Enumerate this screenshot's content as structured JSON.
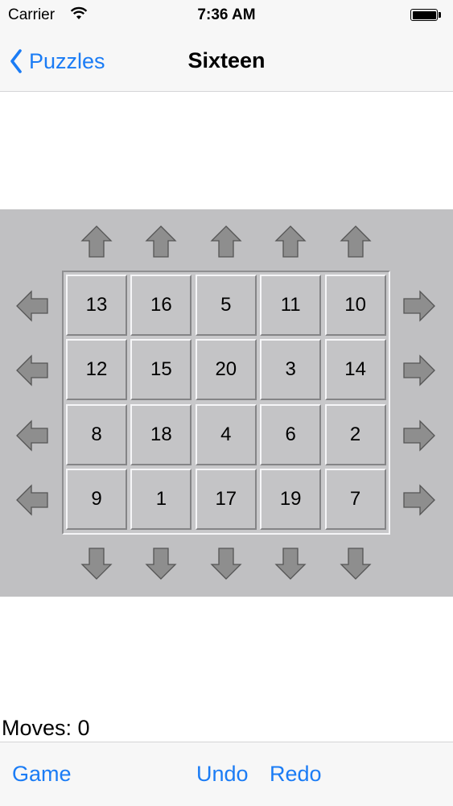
{
  "status": {
    "carrier": "Carrier",
    "time": "7:36 AM"
  },
  "nav": {
    "back_label": "Puzzles",
    "title": "Sixteen"
  },
  "board": {
    "rows": [
      [
        "13",
        "16",
        "5",
        "11",
        "10"
      ],
      [
        "12",
        "15",
        "20",
        "3",
        "14"
      ],
      [
        "8",
        "18",
        "4",
        "6",
        "2"
      ],
      [
        "9",
        "1",
        "17",
        "19",
        "7"
      ]
    ]
  },
  "moves_label": "Moves: 0",
  "toolbar": {
    "game_label": "Game",
    "undo_label": "Undo",
    "redo_label": "Redo"
  },
  "icons": {
    "up": "arrow-up-icon",
    "down": "arrow-down-icon",
    "left": "arrow-left-icon",
    "right": "arrow-right-icon"
  },
  "colors": {
    "accent": "#1b7cf5",
    "game_background": "#c0c0c2",
    "arrow_fill": "#8e8e8e"
  }
}
